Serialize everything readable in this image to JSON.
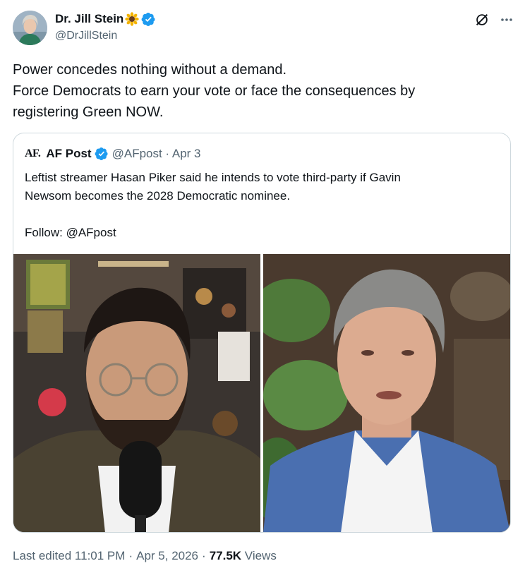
{
  "author": {
    "name": "Dr. Jill Stein",
    "handle": "@DrJillStein"
  },
  "post": {
    "lines": [
      "Power concedes nothing without a demand.",
      "Force Democrats to earn your vote or face the consequences by",
      "registering Green NOW."
    ]
  },
  "quote": {
    "logo_text": "AF.",
    "name": "AF Post",
    "meta": "@AFpost · Apr 3",
    "lines": [
      "Leftist streamer Hasan Piker said he intends to vote third-party if Gavin",
      "Newsom becomes the 2028 Democratic nominee."
    ],
    "follow": "Follow: @AFpost"
  },
  "footer": {
    "edited_label": "Last edited",
    "time": "11:01 PM",
    "date": "Apr 5, 2026",
    "views_count": "77.5K",
    "views_label": "Views",
    "separator": "·"
  },
  "icons": {
    "verified": "verified-badge-icon",
    "sunflower": "sunflower-emoji-icon",
    "grok": "grok-icon",
    "more": "more-icon"
  },
  "colors": {
    "verified_blue": "#1d9bf0",
    "secondary_text": "#536471",
    "primary_text": "#0f1419",
    "border": "#cfd9de"
  }
}
